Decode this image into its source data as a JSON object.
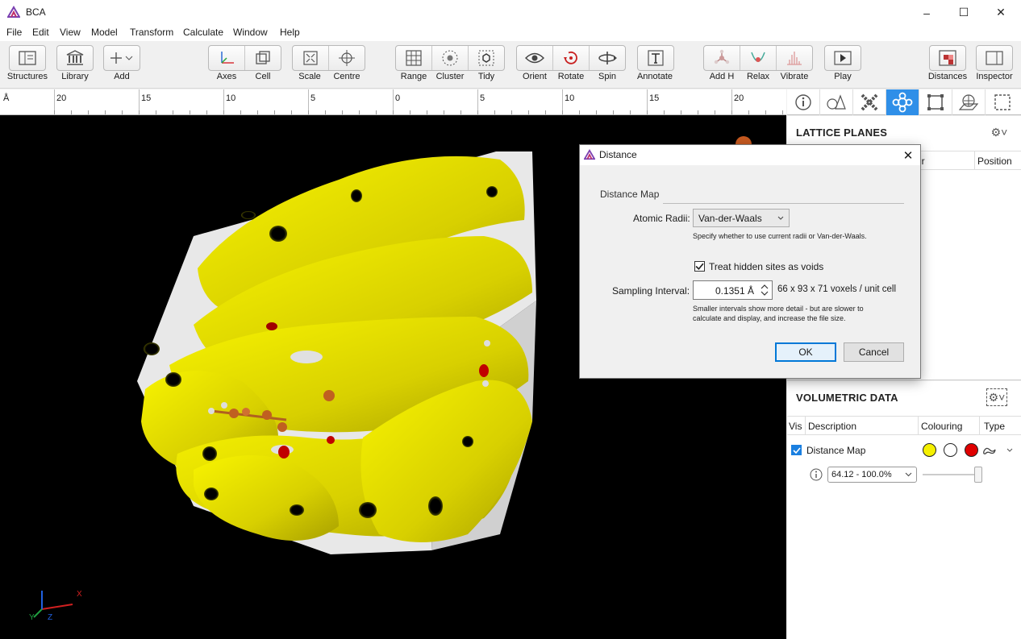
{
  "app": {
    "title": "BCA"
  },
  "window_controls": {
    "minimize": "–",
    "maximize": "☐",
    "close": "✕"
  },
  "menu": [
    "File",
    "Edit",
    "View",
    "Model",
    "Transform",
    "Calculate",
    "Window",
    "Help"
  ],
  "toolbar": {
    "structures": "Structures",
    "library": "Library",
    "add": "Add",
    "axes": "Axes",
    "cell": "Cell",
    "scale": "Scale",
    "centre": "Centre",
    "range": "Range",
    "cluster": "Cluster",
    "tidy": "Tidy",
    "orient": "Orient",
    "rotate": "Rotate",
    "spin": "Spin",
    "annotate": "Annotate",
    "add_h": "Add H",
    "relax": "Relax",
    "vibrate": "Vibrate",
    "play": "Play",
    "distances": "Distances",
    "inspector": "Inspector"
  },
  "ruler": {
    "unit": "Å",
    "labels": [
      "20",
      "15",
      "10",
      "5",
      "0",
      "5",
      "10",
      "15",
      "20"
    ]
  },
  "axes_gizmo": {
    "x": "X",
    "y": "Y",
    "z": "Z"
  },
  "lattice_planes": {
    "title": "LATTICE PLANES",
    "col_colour_partial": "ur",
    "col_position": "Position"
  },
  "volumetric": {
    "title": "VOLUMETRIC DATA",
    "col_vis": "Vis",
    "col_description": "Description",
    "col_colouring": "Colouring",
    "col_type": "Type",
    "row_description": "Distance Map",
    "row_checked": true,
    "colours": [
      "#f5f000",
      "#ffffff",
      "#e00000"
    ],
    "range_value": "64.12 - 100.0%"
  },
  "dialog": {
    "title": "Distance",
    "section": "Distance Map",
    "atomic_radii_label": "Atomic Radii:",
    "atomic_radii_value": "Van-der-Waals",
    "atomic_radii_hint": "Specify whether to use current radii or Van-der-Waals.",
    "treat_hidden_label": "Treat hidden sites as voids",
    "treat_hidden_checked": true,
    "sampling_label": "Sampling Interval:",
    "sampling_value": "0.1351 Å",
    "voxels_text": "66 x 93 x 71 voxels / unit cell",
    "sampling_hint_1": "Smaller intervals show more detail - but are slower to",
    "sampling_hint_2": "calculate and display, and increase the file size.",
    "ok": "OK",
    "cancel": "Cancel"
  }
}
